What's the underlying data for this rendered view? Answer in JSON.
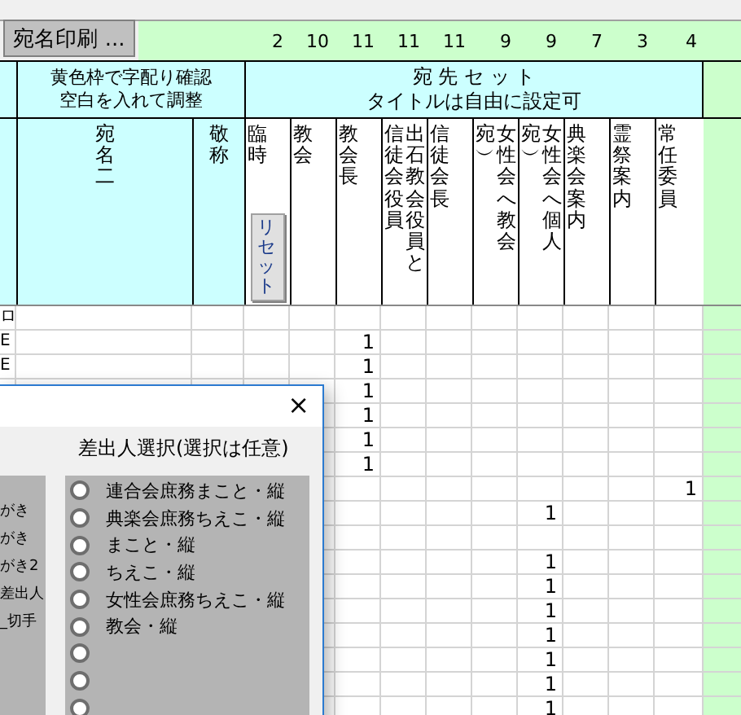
{
  "toolbar": {
    "button": "宛名印刷 ..."
  },
  "counts": [
    "2",
    "10",
    "11",
    "11",
    "11",
    "9",
    "9",
    "7",
    "3",
    "4"
  ],
  "header": {
    "note": [
      "黄色枠で字配り確認",
      "空白を入れて調整"
    ],
    "set_title": [
      "宛 先 セ ッ ト",
      "タイトルは自由に設定可"
    ]
  },
  "columns": [
    {
      "lines": [
        "宛名二"
      ]
    },
    {
      "lines": [
        "敬称"
      ]
    },
    {
      "lines": [
        "臨時"
      ],
      "button": "リセット"
    },
    {
      "lines": [
        "教会"
      ]
    },
    {
      "lines": [
        "教会長"
      ]
    },
    {
      "lines": [
        "信徒会役員",
        "出石教会役員と"
      ]
    },
    {
      "lines": [
        "信徒会長"
      ]
    },
    {
      "lines": [
        "宛︶",
        "女性会へ教会"
      ]
    },
    {
      "lines": [
        "宛︶",
        "女性会へ個人"
      ]
    },
    {
      "lines": [
        "典楽会案内"
      ]
    },
    {
      "lines": [
        "霊祭案内"
      ]
    },
    {
      "lines": [
        "常任委員"
      ]
    }
  ],
  "rows": [
    {
      "col_a": "ロ"
    },
    {
      "col_a": "E",
      "column_5": "1"
    },
    {
      "col_a": "E",
      "column_5": "1"
    },
    {
      "column_5": "1"
    },
    {
      "column_5": "1"
    },
    {
      "column_5": "1"
    },
    {
      "column_5": "1"
    },
    {
      "column_12": "1"
    },
    {
      "column_9": "1"
    },
    {},
    {
      "column_9": "1"
    },
    {
      "column_9": "1"
    },
    {
      "column_9": "1"
    },
    {
      "column_9": "1"
    },
    {
      "column_9": "1"
    },
    {
      "column_9": "1"
    },
    {
      "column_9": "1"
    }
  ],
  "dialog": {
    "close": "×",
    "heading": "差出人選択(選択は任意)",
    "left_items": [
      "がき",
      "がき",
      "がき2",
      "差出人",
      "_切手"
    ],
    "options": [
      {
        "label": "連合会庶務まこと・縦",
        "selected": false
      },
      {
        "label": "典楽会庶務ちえこ・縦",
        "selected": false
      },
      {
        "label": "まこと・縦",
        "selected": false
      },
      {
        "label": "ちえこ・縦",
        "selected": false
      },
      {
        "label": "女性会庶務ちえこ・縦",
        "selected": false
      },
      {
        "label": "教会・縦",
        "selected": false
      },
      {
        "selected": false
      },
      {
        "selected": false
      },
      {
        "selected": false
      }
    ]
  }
}
